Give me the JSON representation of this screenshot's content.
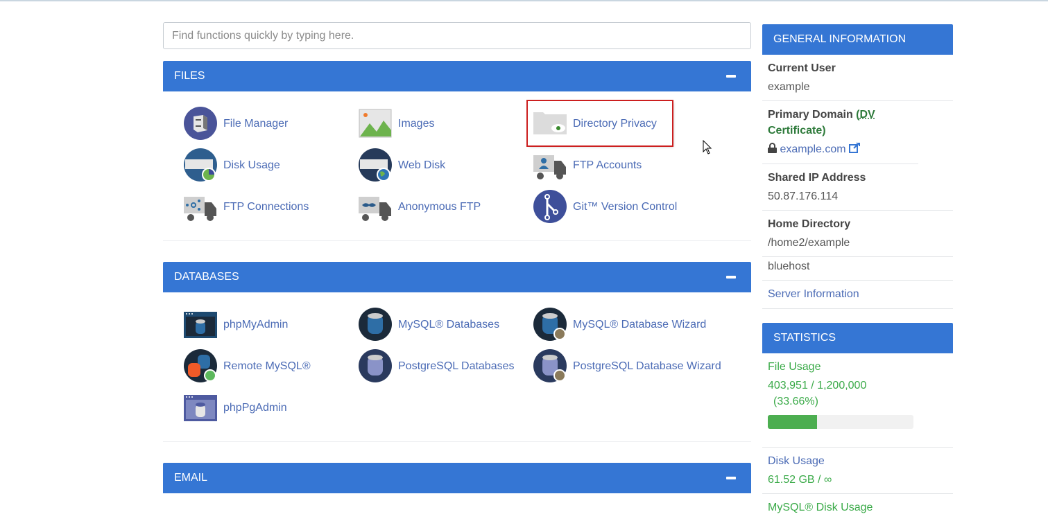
{
  "search": {
    "placeholder": "Find functions quickly by typing here."
  },
  "sections": [
    {
      "title": "FILES",
      "items": [
        {
          "label": "File Manager",
          "icon": "file-manager-icon"
        },
        {
          "label": "Images",
          "icon": "images-icon"
        },
        {
          "label": "Directory Privacy",
          "icon": "directory-privacy-icon",
          "highlighted": true
        },
        {
          "label": "Disk Usage",
          "icon": "disk-usage-icon"
        },
        {
          "label": "Web Disk",
          "icon": "web-disk-icon"
        },
        {
          "label": "FTP Accounts",
          "icon": "ftp-accounts-icon"
        },
        {
          "label": "FTP Connections",
          "icon": "ftp-connections-icon"
        },
        {
          "label": "Anonymous FTP",
          "icon": "anonymous-ftp-icon"
        },
        {
          "label": "Git™ Version Control",
          "icon": "git-icon"
        }
      ]
    },
    {
      "title": "DATABASES",
      "items": [
        {
          "label": "phpMyAdmin",
          "icon": "phpmyadmin-icon"
        },
        {
          "label": "MySQL® Databases",
          "icon": "mysql-databases-icon"
        },
        {
          "label": "MySQL® Database Wizard",
          "icon": "mysql-wizard-icon"
        },
        {
          "label": "Remote MySQL®",
          "icon": "remote-mysql-icon"
        },
        {
          "label": "PostgreSQL Databases",
          "icon": "postgresql-databases-icon"
        },
        {
          "label": "PostgreSQL Database Wizard",
          "icon": "postgresql-wizard-icon"
        },
        {
          "label": "phpPgAdmin",
          "icon": "phppgadmin-icon"
        }
      ]
    },
    {
      "title": "EMAIL",
      "items": []
    }
  ],
  "general": {
    "title": "GENERAL INFORMATION",
    "current_user_label": "Current User",
    "current_user": "example",
    "primary_domain_label": "Primary Domain",
    "dv_open": "(",
    "dv_abbr": "DV",
    "dv_rest": " Certificate)",
    "domain": "example.com",
    "shared_ip_label": "Shared IP Address",
    "shared_ip": "50.87.176.114",
    "home_dir_label": "Home Directory",
    "home_dir": "/home2/example",
    "host": "bluehost",
    "server_info": "Server Information"
  },
  "stats": {
    "title": "STATISTICS",
    "file_usage_label": "File Usage",
    "file_usage_value": "403,951 / 1,200,000",
    "file_usage_pct_text": "(33.66%)",
    "file_usage_fraction": 0.3366,
    "disk_usage_label": "Disk Usage",
    "disk_usage_value": "61.52 GB / ∞",
    "mysql_disk_label": "MySQL® Disk Usage"
  }
}
